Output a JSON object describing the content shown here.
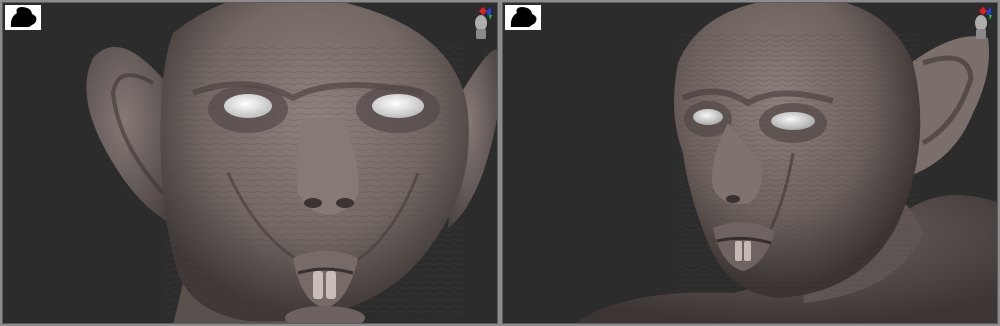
{
  "viewports": [
    {
      "id": "front",
      "view": "front"
    },
    {
      "id": "three-quarter",
      "view": "three-quarter"
    }
  ],
  "icons": {
    "material_thumbnail": "material-silhouette-icon",
    "navigation_gizmo": "head-gizmo-icon",
    "axis_colors": {
      "x": "#e02020",
      "y": "#20c020",
      "z": "#2040e0"
    }
  },
  "colors": {
    "viewport_bg": "#2c2c2c",
    "app_frame": "#8c8c8c",
    "sculpt_clay": "#7c706c"
  }
}
